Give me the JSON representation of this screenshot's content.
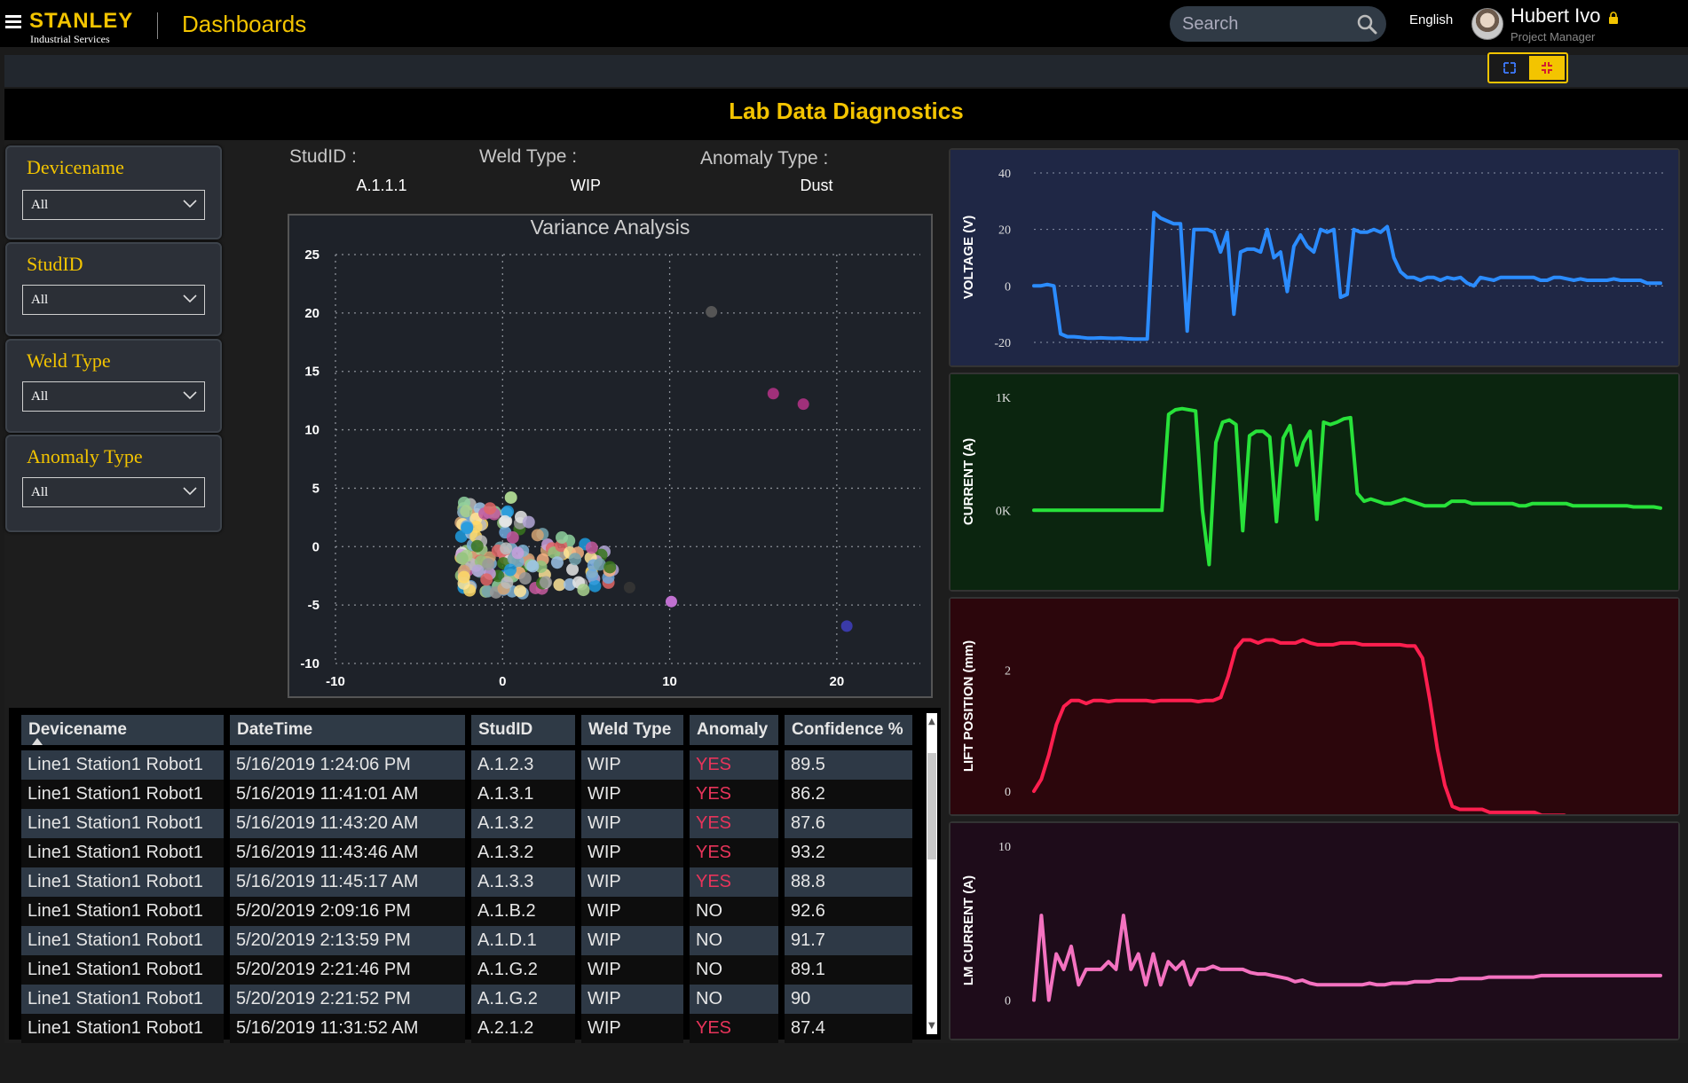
{
  "header": {
    "brand": "STANLEY",
    "brand_sub": "Industrial Services",
    "app_title": "Dashboards",
    "search_placeholder": "Search",
    "language": "English",
    "user_name": "Hubert Ivo",
    "user_role": "Project Manager"
  },
  "report": {
    "title": "Lab Data Diagnostics"
  },
  "slicers": [
    {
      "title": "Devicename",
      "value": "All"
    },
    {
      "title": "StudID",
      "value": "All"
    },
    {
      "title": "Weld Type",
      "value": "All"
    },
    {
      "title": "Anomaly Type",
      "value": "All"
    }
  ],
  "info": {
    "studid_label": "StudID :",
    "studid_value": "A.1.1.1",
    "weld_label": "Weld Type :",
    "weld_value": "WIP",
    "anomaly_label": "Anomaly Type :",
    "anomaly_value": "Dust"
  },
  "table": {
    "columns": [
      "Devicename",
      "DateTime",
      "StudID",
      "Weld Type",
      "Anomaly",
      "Confidence %"
    ],
    "rows": [
      [
        "Line1 Station1 Robot1",
        "5/16/2019 1:24:06 PM",
        "A.1.2.3",
        "WIP",
        "YES",
        "89.5"
      ],
      [
        "Line1 Station1 Robot1",
        "5/16/2019 11:41:01 AM",
        "A.1.3.1",
        "WIP",
        "YES",
        "86.2"
      ],
      [
        "Line1 Station1 Robot1",
        "5/16/2019 11:43:20 AM",
        "A.1.3.2",
        "WIP",
        "YES",
        "87.6"
      ],
      [
        "Line1 Station1 Robot1",
        "5/16/2019 11:43:46 AM",
        "A.1.3.2",
        "WIP",
        "YES",
        "93.2"
      ],
      [
        "Line1 Station1 Robot1",
        "5/16/2019 11:45:17 AM",
        "A.1.3.3",
        "WIP",
        "YES",
        "88.8"
      ],
      [
        "Line1 Station1 Robot1",
        "5/20/2019 2:09:16 PM",
        "A.1.B.2",
        "WIP",
        "NO",
        "92.6"
      ],
      [
        "Line1 Station1 Robot1",
        "5/20/2019 2:13:59 PM",
        "A.1.D.1",
        "WIP",
        "NO",
        "91.7"
      ],
      [
        "Line1 Station1 Robot1",
        "5/20/2019 2:21:46 PM",
        "A.1.G.2",
        "WIP",
        "NO",
        "89.1"
      ],
      [
        "Line1 Station1 Robot1",
        "5/20/2019 2:21:52 PM",
        "A.1.G.2",
        "WIP",
        "NO",
        "90"
      ],
      [
        "Line1 Station1 Robot1",
        "5/16/2019 11:31:52 AM",
        "A.2.1.2",
        "WIP",
        "YES",
        "87.4"
      ]
    ]
  },
  "chart_data": [
    {
      "type": "scatter",
      "title": "Variance Analysis",
      "xlim": [
        -10,
        25
      ],
      "ylim": [
        -10,
        25
      ],
      "xticks": [
        -10,
        0,
        10,
        20
      ],
      "yticks": [
        -10,
        -5,
        0,
        5,
        10,
        15,
        20,
        25
      ],
      "grid": true,
      "outliers": [
        {
          "x": 12.5,
          "y": 20.1,
          "color": "#555555"
        },
        {
          "x": 16.2,
          "y": 13.1,
          "color": "#a0307a"
        },
        {
          "x": 18.0,
          "y": 12.2,
          "color": "#a0307a"
        },
        {
          "x": 10.1,
          "y": -4.7,
          "color": "#c070d0"
        },
        {
          "x": 20.6,
          "y": -6.8,
          "color": "#3a3aa8"
        },
        {
          "x": 7.6,
          "y": -3.5,
          "color": "#333333"
        }
      ],
      "cluster": {
        "x_range": [
          -2.5,
          7
        ],
        "y_range": [
          -4.5,
          4.5
        ],
        "count": 160
      },
      "cluster_colors": [
        "#7fb3d5",
        "#a9d18e",
        "#f4b183",
        "#c9a0dc",
        "#9dc3e6",
        "#ffd966",
        "#c55a9d",
        "#8fd19e",
        "#e6e6e6",
        "#d4a373",
        "#6fa8dc",
        "#b4a7d6",
        "#93c47d",
        "#e06666",
        "#76a5af",
        "#ffe599",
        "#bcbcbc",
        "#1f9bde",
        "#38761d",
        "#999999"
      ]
    },
    {
      "type": "line",
      "ylabel": "VOLTAGE (V)",
      "yticks": [
        40,
        20,
        0,
        -20
      ],
      "ylim": [
        -20,
        40
      ],
      "color": "#2b8cff",
      "background": "#1f2745",
      "values": [
        0,
        0,
        0.5,
        0,
        -17,
        -18,
        -18,
        -18.2,
        -18.5,
        -18.5,
        -18.4,
        -18.5,
        -18.6,
        -18.5,
        -18.7,
        -18.8,
        -18.8,
        -18.8,
        26,
        24,
        23,
        22,
        22,
        -16,
        20,
        20,
        20,
        19,
        12,
        19,
        -10,
        12,
        13,
        13,
        12,
        20,
        10,
        12,
        -2,
        14,
        18,
        14,
        12,
        20,
        19,
        20,
        -4,
        -3,
        20,
        19,
        19,
        20,
        19,
        21,
        10,
        5,
        3,
        3,
        2,
        3,
        3,
        2,
        3,
        2.5,
        3,
        1,
        0,
        3,
        2.5,
        2,
        3,
        3,
        3,
        3,
        3,
        3,
        2,
        2,
        3,
        3,
        2.5,
        2,
        2.5,
        2,
        2,
        2,
        2,
        2.5,
        2,
        2,
        2,
        2,
        1,
        1,
        1
      ]
    },
    {
      "type": "line",
      "ylabel": "CURRENT (A)",
      "yticks": [
        "1K",
        "0K"
      ],
      "ylim": [
        -500,
        1000
      ],
      "color": "#28e23a",
      "background": "#0b250f",
      "values": [
        0,
        0,
        0,
        0,
        0,
        0,
        0,
        0,
        0,
        0,
        0,
        0,
        0,
        0,
        0,
        0,
        0,
        0,
        0,
        0,
        850,
        890,
        900,
        890,
        880,
        0,
        -480,
        600,
        780,
        800,
        760,
        -180,
        660,
        700,
        700,
        650,
        -100,
        640,
        750,
        400,
        600,
        700,
        -80,
        780,
        760,
        780,
        810,
        820,
        150,
        80,
        100,
        80,
        60,
        60,
        80,
        100,
        80,
        60,
        40,
        40,
        40,
        40,
        80,
        80,
        80,
        60,
        60,
        60,
        60,
        60,
        60,
        60,
        40,
        40,
        60,
        60,
        60,
        60,
        60,
        60,
        40,
        40,
        40,
        40,
        40,
        40,
        40,
        40,
        40,
        30,
        30,
        30,
        30,
        20
      ]
    },
    {
      "type": "line",
      "ylabel": "LIFT POSITION (mm)",
      "yticks": [
        2,
        0
      ],
      "ylim": [
        0,
        2.8
      ],
      "color": "#ff1f4f",
      "background": "#2c060c",
      "values": [
        0,
        0.2,
        0.6,
        1.1,
        1.4,
        1.5,
        1.5,
        1.45,
        1.5,
        1.5,
        1.48,
        1.5,
        1.5,
        1.5,
        1.5,
        1.5,
        1.48,
        1.5,
        1.5,
        1.5,
        1.5,
        1.5,
        1.48,
        1.5,
        1.5,
        1.55,
        1.9,
        2.35,
        2.5,
        2.5,
        2.45,
        2.5,
        2.5,
        2.45,
        2.45,
        2.45,
        2.5,
        2.45,
        2.42,
        2.42,
        2.42,
        2.45,
        2.45,
        2.45,
        2.42,
        2.42,
        2.42,
        2.42,
        2.42,
        2.42,
        2.4,
        2.4,
        2.2,
        1.5,
        0.7,
        0.1,
        -0.25,
        -0.3,
        -0.3,
        -0.3,
        -0.3,
        -0.35,
        -0.35,
        -0.35,
        -0.35,
        -0.35,
        -0.35,
        -0.35,
        -0.4,
        -0.4,
        -0.4,
        -0.4,
        -0.45,
        -0.45,
        -0.45,
        -0.45,
        -0.45,
        -0.45,
        -0.48,
        -0.48,
        -0.5,
        -0.5,
        -0.5,
        -0.5,
        -0.5,
        -0.5,
        -0.55
      ]
    },
    {
      "type": "line",
      "ylabel": "LM CURRENT (A)",
      "yticks": [
        10,
        0
      ],
      "ylim": [
        -1,
        10
      ],
      "color": "#f472c0",
      "background": "#1e0c1a",
      "values": [
        0,
        5.5,
        0,
        3,
        2,
        3.5,
        1,
        2,
        2,
        2,
        2.5,
        2,
        5.5,
        2,
        3,
        1,
        3,
        1,
        2.5,
        2,
        2.5,
        1,
        2,
        2,
        2.2,
        2,
        2,
        2,
        2,
        1.8,
        1.7,
        1.7,
        1.6,
        1.5,
        1.4,
        1.2,
        1.3,
        1.1,
        1,
        1,
        1,
        1,
        1,
        1,
        1,
        1.1,
        1,
        1,
        1.1,
        1.1,
        1.1,
        1.2,
        1.2,
        1.2,
        1.3,
        1.3,
        1.3,
        1.4,
        1.4,
        1.4,
        1.4,
        1.5,
        1.5,
        1.5,
        1.5,
        1.5,
        1.5,
        1.5,
        1.6,
        1.6,
        1.6,
        1.6,
        1.6,
        1.6,
        1.6,
        1.6,
        1.6,
        1.6,
        1.6,
        1.6,
        1.6,
        1.6,
        1.6,
        1.6,
        1.6
      ]
    }
  ]
}
